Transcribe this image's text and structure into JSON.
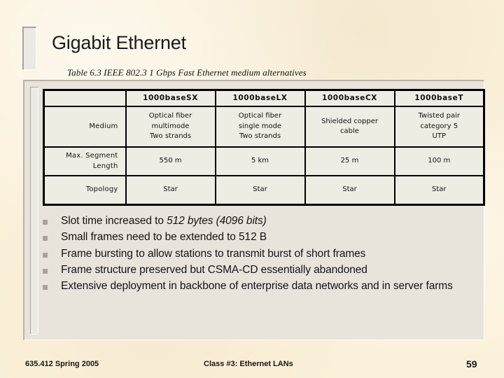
{
  "slide": {
    "title": "Gigabit Ethernet",
    "caption": "Table 6.3  IEEE 802.3 1 Gbps Fast Ethernet medium alternatives"
  },
  "table": {
    "headers": [
      "",
      "1000base SX",
      "1000base LX",
      "1000base CX",
      "1000base T"
    ],
    "header_texts": {
      "blank": "",
      "sx": "1000baseSX",
      "lx": "1000baseLX",
      "cx": "1000baseCX",
      "t": "1000baseT"
    },
    "rows": [
      {
        "label": "Medium",
        "cells": [
          "Optical fiber\nmultimode\nTwo strands",
          "Optical fiber\nsingle mode\nTwo strands",
          "Shielded copper\ncable",
          "Twisted pair\ncategory 5\nUTP"
        ],
        "cells_lines": {
          "sx": [
            "Optical fiber",
            "multimode",
            "Two strands"
          ],
          "lx": [
            "Optical fiber",
            "single mode",
            "Two strands"
          ],
          "cx": [
            "Shielded copper",
            "cable"
          ],
          "t": [
            "Twisted pair",
            "category 5",
            "UTP"
          ]
        }
      },
      {
        "label": "Max. Segment Length",
        "label_lines": [
          "Max. Segment",
          "Length"
        ],
        "cells": [
          "550 m",
          "5 km",
          "25 m",
          "100 m"
        ]
      },
      {
        "label": "Topology",
        "cells": [
          "Star",
          "Star",
          "Star",
          "Star"
        ]
      }
    ]
  },
  "bullets": [
    {
      "pre": "Slot time increased to ",
      "em": "512 bytes (4096 bits)",
      "post": ""
    },
    {
      "pre": "Small frames need to be extended to 512 B",
      "em": "",
      "post": ""
    },
    {
      "pre": "Frame bursting to allow stations to transmit burst of short frames",
      "em": "",
      "post": ""
    },
    {
      "pre": "Frame structure preserved but CSMA-CD essentially abandoned",
      "em": "",
      "post": ""
    },
    {
      "pre": "Extensive deployment in backbone of enterprise data networks and in server farms",
      "em": "",
      "post": ""
    }
  ],
  "footer": {
    "left": "635.412 Spring 2005",
    "center": "Class #3:  Ethernet LANs",
    "page": "59"
  },
  "colors": {
    "background": "#fbf0d9",
    "panel": "#e8e4dc",
    "table_cell": "#efece3",
    "table_border": "#000000",
    "bullet_marker": "#a8a49c",
    "text": "#141414"
  }
}
